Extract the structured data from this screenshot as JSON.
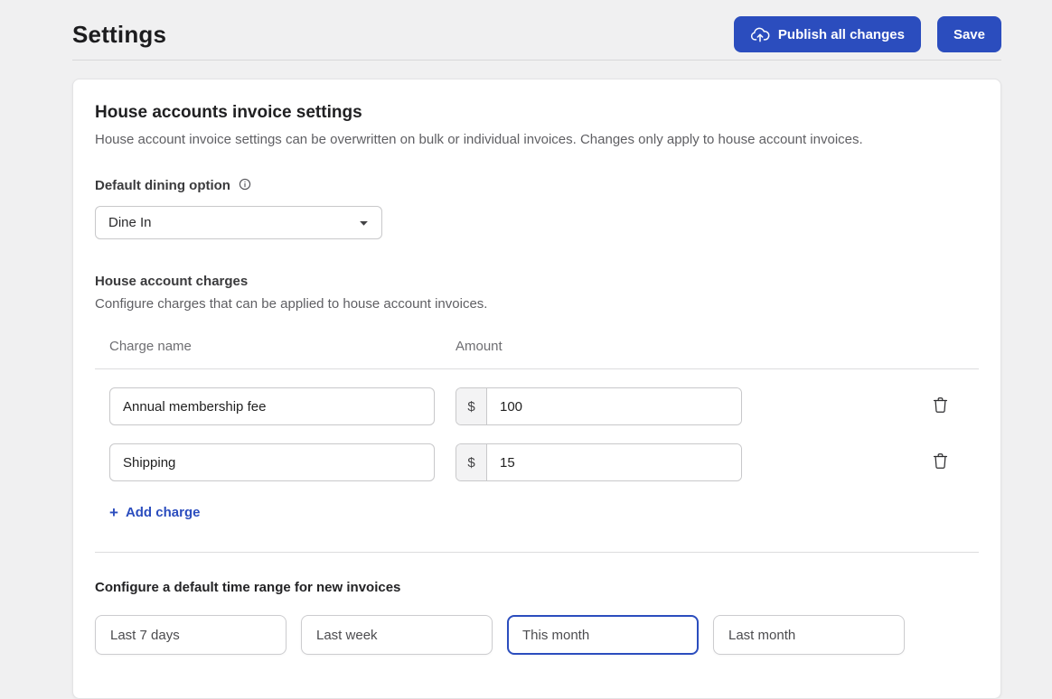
{
  "header": {
    "title": "Settings",
    "publish_button": "Publish all changes",
    "save_button": "Save"
  },
  "card": {
    "title": "House accounts invoice settings",
    "subtitle": "House account invoice settings can be overwritten on bulk or individual invoices. Changes only apply to house account invoices.",
    "dining": {
      "label": "Default dining option",
      "selected": "Dine In"
    },
    "charges": {
      "title": "House account charges",
      "subtitle": "Configure charges that can be applied to house account invoices.",
      "columns": {
        "name": "Charge name",
        "amount": "Amount"
      },
      "currency": "$",
      "rows": [
        {
          "name": "Annual membership fee",
          "amount": "100"
        },
        {
          "name": "Shipping",
          "amount": "15"
        }
      ],
      "add": {
        "icon": "+",
        "label": "Add charge"
      }
    },
    "time_range": {
      "label": "Configure a default time range for new invoices",
      "options": [
        {
          "label": "Last 7 days",
          "selected": false
        },
        {
          "label": "Last week",
          "selected": false
        },
        {
          "label": "This month",
          "selected": true
        },
        {
          "label": "Last month",
          "selected": false
        }
      ]
    }
  },
  "icons": {
    "publish": "cloud-upload",
    "dining_help": "info-circle",
    "select": "chevron-down",
    "delete_row": "trash",
    "add_row": "plus"
  },
  "colors": {
    "accent": "#2b4dbe",
    "page_bg": "#f0f0f1"
  }
}
